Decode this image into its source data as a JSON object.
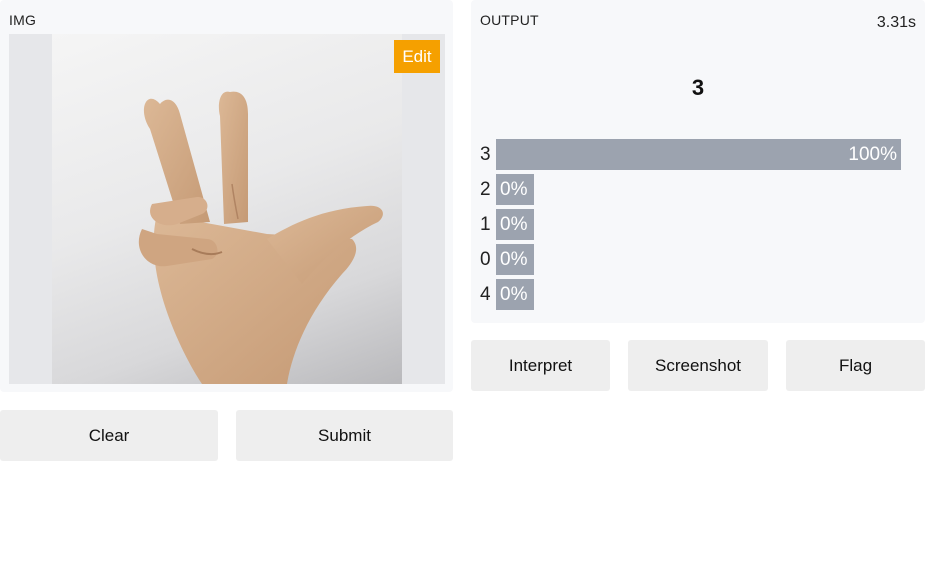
{
  "input": {
    "label": "IMG",
    "edit_label": "Edit"
  },
  "output": {
    "label": "OUTPUT",
    "time": "3.31s",
    "prediction": "3",
    "confidences": [
      {
        "label": "3",
        "value": 1.0,
        "text": "100%"
      },
      {
        "label": "2",
        "value": 0.0,
        "text": "0%"
      },
      {
        "label": "1",
        "value": 0.0,
        "text": "0%"
      },
      {
        "label": "0",
        "value": 0.0,
        "text": "0%"
      },
      {
        "label": "4",
        "value": 0.0,
        "text": "0%"
      }
    ]
  },
  "buttons": {
    "clear": "Clear",
    "submit": "Submit",
    "interpret": "Interpret",
    "screenshot": "Screenshot",
    "flag": "Flag"
  },
  "colors": {
    "edit": "#f5a000",
    "bar": "#9ca3af",
    "button_bg": "#eeeeee"
  }
}
